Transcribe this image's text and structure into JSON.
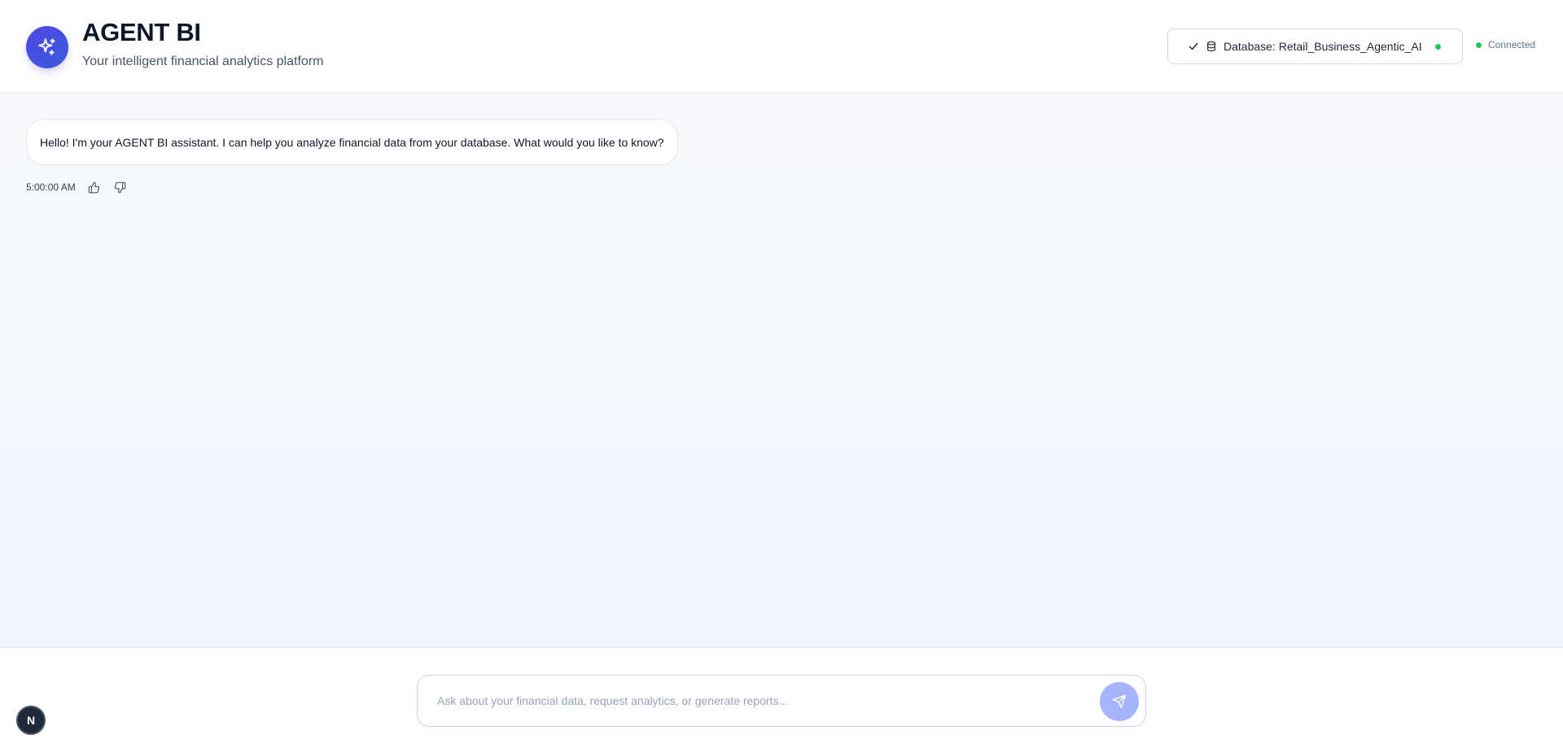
{
  "header": {
    "title": "AGENT BI",
    "subtitle": "Your intelligent financial analytics platform",
    "logo_icon": "sparkles-icon",
    "database_label": "Database: Retail_Business_Agentic_AI",
    "status_text": "Connected"
  },
  "chat": {
    "messages": [
      {
        "text": "Hello! I'm your AGENT BI assistant. I can help you analyze financial data from your database. What would you like to know?",
        "timestamp": "5:00:00 AM"
      }
    ]
  },
  "composer": {
    "placeholder": "Ask about your financial data, request analytics, or generate reports...",
    "value": ""
  },
  "badge": {
    "letter": "N"
  },
  "colors": {
    "accent": "#4f46e5",
    "send_button": "#a5b4fc",
    "status_green": "#22c55e",
    "chat_background": "#f4f7fc"
  }
}
